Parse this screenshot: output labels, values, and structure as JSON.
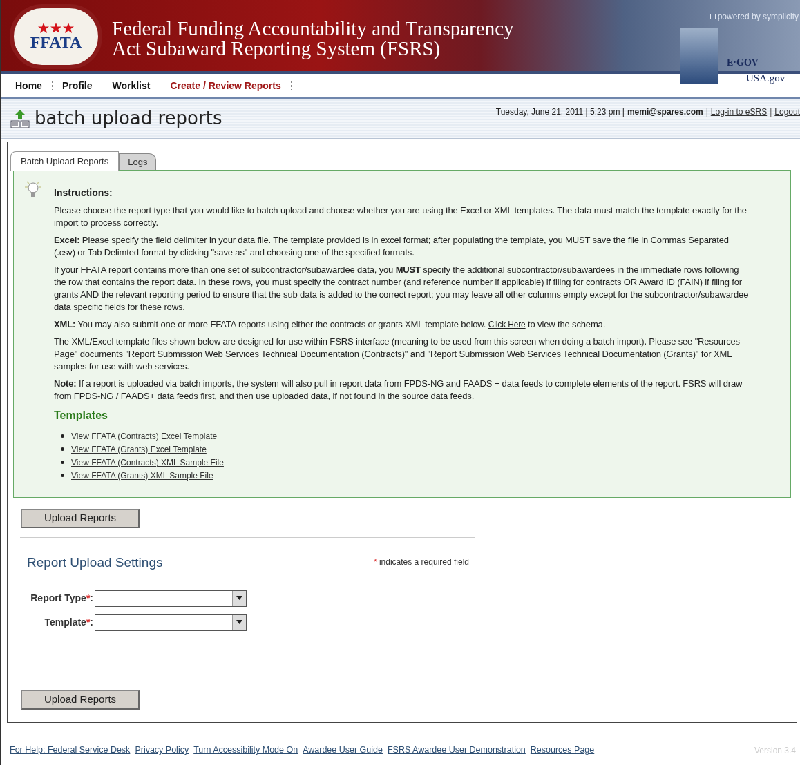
{
  "header": {
    "seal_text": "FFATA",
    "title_lines": [
      "Federal Funding Accountability and Transparency",
      "Act Subaward Reporting System (FSRS)"
    ],
    "powered_by": "powered by symplicity",
    "egov": "E·GOV",
    "usagov": "USA.gov"
  },
  "nav": [
    {
      "label": "Home",
      "selected": false
    },
    {
      "label": "Profile",
      "selected": false
    },
    {
      "label": "Worklist",
      "selected": false
    },
    {
      "label": "Create / Review Reports",
      "selected": true
    }
  ],
  "page_title": "batch upload reports",
  "status": {
    "separator": "|",
    "datetime": "Tuesday, June 21, 2011 | 5:23 pm |",
    "user": "memi@spares.com",
    "links": [
      "Log-in to eSRS",
      "Logout"
    ]
  },
  "tabs": [
    {
      "label": "Batch Upload Reports",
      "selected": true
    },
    {
      "label": "Logs",
      "selected": false
    }
  ],
  "instructions": {
    "heading": "Instructions:",
    "paragraphs": [
      [
        {
          "kind": "text",
          "text": "Please choose the report type that you would like to batch upload and choose whether you are using the Excel or XML templates. The data must match the template exactly for the import to process correctly."
        }
      ],
      [
        {
          "kind": "text",
          "text": "**Excel:** Please specify the field delimiter in your data file. The template provided is in excel format; after populating the template, you MUST save the file in Commas Separated (.csv) or Tab Delimted format by clicking \"save as\" and choosing one of the specified formats."
        }
      ],
      [
        {
          "kind": "text",
          "text": "If your FFATA report contains more than one set of subcontractor/subawardee data, you **MUST** specify the additional subcontractor/subawardees in the immediate rows following the row that contains the report data. In these rows, you must specify the contract number (and reference number if applicable) if filing for contracts OR Award ID (FAIN) if filing for grants AND the relevant reporting period to ensure that the sub data is added to the correct report; you may leave all other columns empty except for the subcontractor/subawardee data specific fields for these rows."
        }
      ],
      [
        {
          "kind": "text",
          "text": "**XML:** You may also submit one or more FFATA reports using either the contracts or grants XML template below. "
        },
        {
          "kind": "link",
          "text": "Click Here"
        },
        {
          "kind": "text",
          "text": " to view the schema."
        }
      ],
      [
        {
          "kind": "text",
          "text": "The XML/Excel template files shown below are designed for use within FSRS interface (meaning to be used from this screen when doing a batch import). Please see \"Resources Page\" documents \"Report Submission Web Services Technical Documentation (Contracts)\" and \"Report Submission Web Services Technical Documentation (Grants)\" for XML samples for use with web services."
        }
      ],
      [
        {
          "kind": "text",
          "text": "**Note:** If a report is uploaded via batch imports, the system will also pull in report data from FPDS-NG and FAADS + data feeds to complete elements of the report. FSRS will draw from FPDS-NG / FAADS+ data feeds first, and then use uploaded data, if not found in the source data feeds."
        }
      ]
    ],
    "templates_heading": "Templates",
    "templates": [
      "View FFATA (Contracts) Excel Template",
      "View FFATA (Grants) Excel Template",
      "View FFATA (Contracts) XML Sample File",
      "View FFATA (Grants) XML Sample File"
    ]
  },
  "upload_buttons": [
    "Upload Reports",
    "Upload Reports"
  ],
  "settings": {
    "title": "Report Upload Settings",
    "required_mark": "*",
    "required_note": "indicates a required field",
    "label_suffix": ":",
    "fields": [
      {
        "label": "Report Type",
        "required": true
      },
      {
        "label": "Template",
        "required": true
      }
    ]
  },
  "footer": {
    "links": [
      "For Help: Federal Service Desk",
      "Privacy Policy",
      "Turn Accessibility Mode On",
      "Awardee User Guide",
      "FSRS Awardee User Demonstration",
      "Resources Page"
    ],
    "version": "Version 3.4"
  }
}
